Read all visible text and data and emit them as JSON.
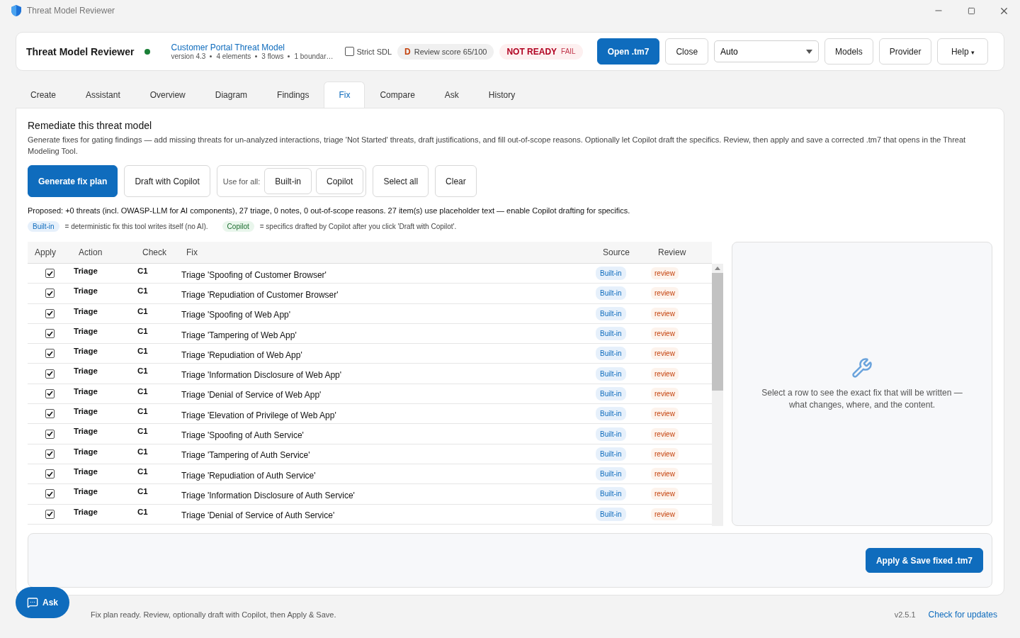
{
  "window": {
    "title": "Threat Model Reviewer"
  },
  "header": {
    "app_name": "Threat Model Reviewer",
    "model_title": "Customer Portal Threat Model",
    "meta": [
      "version 4.3",
      "4 elements",
      "3 flows",
      "1 boundar…"
    ],
    "strict_sdl": {
      "label": "Strict SDL",
      "checked": false
    },
    "score": {
      "grade": "D",
      "label": "Review score 65/100"
    },
    "readiness": {
      "label": "NOT READY",
      "badge": "FAIL"
    },
    "open_button": "Open .tm7",
    "close_button": "Close",
    "provider_select": "Auto",
    "buttons": [
      "Models",
      "Provider"
    ],
    "help": "Help",
    "help_caret": "▾"
  },
  "tabs": [
    {
      "label": "Create",
      "selected": false
    },
    {
      "label": "Assistant",
      "selected": false
    },
    {
      "label": "Overview",
      "selected": false
    },
    {
      "label": "Diagram",
      "selected": false
    },
    {
      "label": "Findings",
      "selected": false
    },
    {
      "label": "Fix",
      "selected": true
    },
    {
      "label": "Compare",
      "selected": false
    },
    {
      "label": "Ask",
      "selected": false
    },
    {
      "label": "History",
      "selected": false
    }
  ],
  "fix": {
    "title": "Remediate this threat model",
    "description": "Generate fixes for gating findings — add missing threats for un-analyzed interactions, triage 'Not Started' threats, draft justifications, and fill out-of-scope reasons. Optionally let Copilot draft the specifics. Review, then apply and save a corrected .tm7 that opens in the Threat Modeling Tool.",
    "generate_button": "Generate fix plan",
    "draft_button": "Draft with Copilot",
    "use_for_all": {
      "label": "Use for all:",
      "options": [
        "Built-in",
        "Copilot"
      ]
    },
    "select_all": "Select all",
    "clear": "Clear",
    "proposal": "Proposed: +0 threats (incl. OWASP-LLM for AI components), 27 triage, 0 notes, 0 out-of-scope reasons. 27 item(s) use placeholder text — enable Copilot drafting for specifics.",
    "legend": [
      {
        "kind": "builtin",
        "tag": "Built-in",
        "text": "= deterministic fix this tool writes itself (no AI)."
      },
      {
        "kind": "copilot",
        "tag": "Copilot",
        "text": "= specifics drafted by Copilot after you click 'Draft with Copilot'."
      }
    ],
    "table": {
      "columns": [
        "Apply",
        "Action",
        "Check",
        "Fix",
        "Source",
        "Review"
      ],
      "rows": [
        {
          "checked": true,
          "action": "Triage",
          "check": "C1",
          "fix": "Triage 'Spoofing of Customer Browser'",
          "source": "Built-in",
          "review": "review"
        },
        {
          "checked": true,
          "action": "Triage",
          "check": "C1",
          "fix": "Triage 'Repudiation of Customer Browser'",
          "source": "Built-in",
          "review": "review"
        },
        {
          "checked": true,
          "action": "Triage",
          "check": "C1",
          "fix": "Triage 'Spoofing of Web App'",
          "source": "Built-in",
          "review": "review"
        },
        {
          "checked": true,
          "action": "Triage",
          "check": "C1",
          "fix": "Triage 'Tampering of Web App'",
          "source": "Built-in",
          "review": "review"
        },
        {
          "checked": true,
          "action": "Triage",
          "check": "C1",
          "fix": "Triage 'Repudiation of Web App'",
          "source": "Built-in",
          "review": "review"
        },
        {
          "checked": true,
          "action": "Triage",
          "check": "C1",
          "fix": "Triage 'Information Disclosure of Web App'",
          "source": "Built-in",
          "review": "review"
        },
        {
          "checked": true,
          "action": "Triage",
          "check": "C1",
          "fix": "Triage 'Denial of Service of Web App'",
          "source": "Built-in",
          "review": "review"
        },
        {
          "checked": true,
          "action": "Triage",
          "check": "C1",
          "fix": "Triage 'Elevation of Privilege of Web App'",
          "source": "Built-in",
          "review": "review"
        },
        {
          "checked": true,
          "action": "Triage",
          "check": "C1",
          "fix": "Triage 'Spoofing of Auth Service'",
          "source": "Built-in",
          "review": "review"
        },
        {
          "checked": true,
          "action": "Triage",
          "check": "C1",
          "fix": "Triage 'Tampering of Auth Service'",
          "source": "Built-in",
          "review": "review"
        },
        {
          "checked": true,
          "action": "Triage",
          "check": "C1",
          "fix": "Triage 'Repudiation of Auth Service'",
          "source": "Built-in",
          "review": "review"
        },
        {
          "checked": true,
          "action": "Triage",
          "check": "C1",
          "fix": "Triage 'Information Disclosure of Auth Service'",
          "source": "Built-in",
          "review": "review"
        },
        {
          "checked": true,
          "action": "Triage",
          "check": "C1",
          "fix": "Triage 'Denial of Service of Auth Service'",
          "source": "Built-in",
          "review": "review"
        }
      ]
    },
    "detail_hint": "Select a row to see the exact fix that will be written — what changes, where, and the content.",
    "apply_button": "Apply & Save fixed .tm7"
  },
  "ask_button": "Ask",
  "status_bar": {
    "message": "Fix plan ready. Review, optionally draft with Copilot, then Apply & Save.",
    "version": "v2.5.1",
    "update_link": "Check for updates"
  }
}
